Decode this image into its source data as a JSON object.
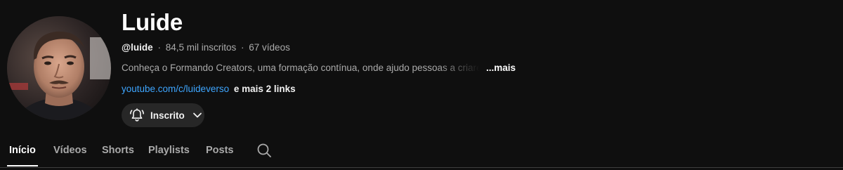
{
  "channel": {
    "name": "Luide",
    "handle": "@luide",
    "subscribers": "84,5 mil inscritos",
    "videos": "67 vídeos",
    "separator": "·",
    "description": "Conheça o Formando Creators, uma formação contínua, onde ajudo pessoas a criarem e",
    "more_label": "...mais",
    "link_text": "youtube.com/c/luideverso",
    "more_links": "e mais 2 links"
  },
  "subscribe_button": {
    "label": "Inscrito",
    "icon": "bell-ring-icon",
    "dropdown_icon": "chevron-down-icon"
  },
  "tabs": [
    {
      "label": "Início",
      "active": true
    },
    {
      "label": "Vídeos",
      "active": false
    },
    {
      "label": "Shorts",
      "active": false
    },
    {
      "label": "Playlists",
      "active": false
    },
    {
      "label": "Posts",
      "active": false
    }
  ],
  "search_tab_icon": "search-icon",
  "colors": {
    "background": "#0f0f0f",
    "link": "#3ea6ff",
    "button_bg": "#272727",
    "muted_text": "#aaaaaa"
  }
}
